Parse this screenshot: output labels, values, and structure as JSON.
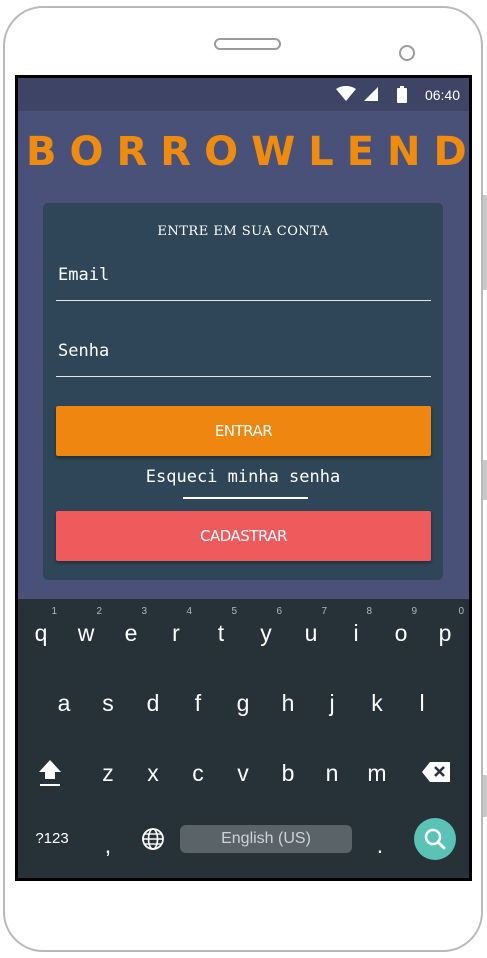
{
  "status_bar": {
    "time": "06:40"
  },
  "app": {
    "logo": "BORROWLEND",
    "login": {
      "title": "ENTRE EM SUA CONTA",
      "email_placeholder": "Email",
      "password_placeholder": "Senha",
      "login_button": "ENTRAR",
      "forgot_link": "Esqueci minha senha",
      "register_button": "CADASTRAR"
    }
  },
  "keyboard": {
    "row1": [
      {
        "key": "q",
        "hint": "1"
      },
      {
        "key": "w",
        "hint": "2"
      },
      {
        "key": "e",
        "hint": "3"
      },
      {
        "key": "r",
        "hint": "4"
      },
      {
        "key": "t",
        "hint": "5"
      },
      {
        "key": "y",
        "hint": "6"
      },
      {
        "key": "u",
        "hint": "7"
      },
      {
        "key": "i",
        "hint": "8"
      },
      {
        "key": "o",
        "hint": "9"
      },
      {
        "key": "p",
        "hint": "0"
      }
    ],
    "row2": [
      "a",
      "s",
      "d",
      "f",
      "g",
      "h",
      "j",
      "k",
      "l"
    ],
    "row3": [
      "z",
      "x",
      "c",
      "v",
      "b",
      "n",
      "m"
    ],
    "symbols_key": "?123",
    "comma_key": ",",
    "period_key": ".",
    "space_label": "English (US)",
    "icons": [
      "shift-icon",
      "backspace-icon",
      "globe-icon",
      "search-icon",
      "wifi-icon",
      "signal-icon",
      "battery-icon"
    ]
  },
  "colors": {
    "background": "#495179",
    "card": "#2e4657",
    "logo": "#ef8c10",
    "login_button": "#ef860f",
    "register_button": "#ef5a5c",
    "keyboard": "#263238",
    "go_key": "#5bc2b6"
  }
}
